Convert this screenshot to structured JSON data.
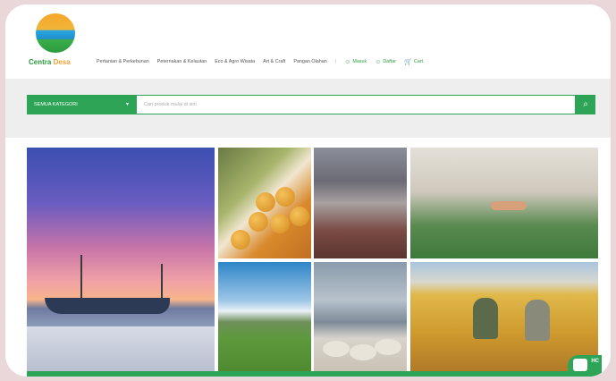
{
  "brand": {
    "name_part1": "Centra",
    "name_part2": "Desa"
  },
  "nav": {
    "links": [
      "Pertanian & Perkebunan",
      "Peternakan & Kelautan",
      "Eco & Agro Wisata",
      "Art & Craft",
      "Pangan Olahan"
    ],
    "masuk": "Masuk",
    "daftar": "Daftar",
    "cart": "Cart"
  },
  "search": {
    "category_label": "SEMUA KATEGORI",
    "placeholder": "Cari produk mulai di sini"
  },
  "help_badge": "HC",
  "colors": {
    "brand_green": "#2ea556",
    "background": "#ead7d9"
  }
}
